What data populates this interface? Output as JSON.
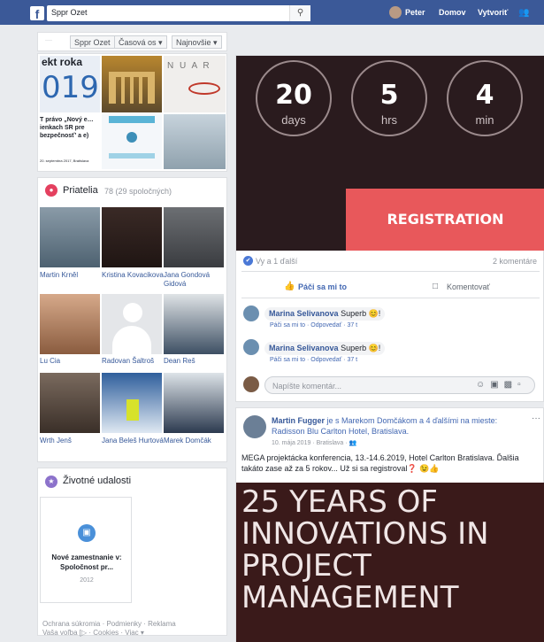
{
  "topbar": {
    "search_value": "Sppr Ozet",
    "user_name": "Peter",
    "home_label": "Domov",
    "create_label": "Vytvoriť"
  },
  "tabs": {
    "tab1": "Sppr Ozet",
    "tab2": "Časová os ▾",
    "tab3": "Najnovšie ▾"
  },
  "photos": {
    "tile1_text": "ekt roka",
    "tile1_year": "019",
    "tile3_text": "N U A R",
    "tile4_text": "T právo „Nový e… ienkach SR pre bezpečnosť' a e)",
    "tile4_date": "20. septembra 2017, Bratislava"
  },
  "friends": {
    "title": "Priatelia",
    "count": "78 (29 spoločných)",
    "list": [
      {
        "name": "Martin Krněl"
      },
      {
        "name": "Kristina Kovacikova"
      },
      {
        "name": "Jana Gondová Gidová"
      },
      {
        "name": "Lu Cia"
      },
      {
        "name": "Radovan Šaltroš"
      },
      {
        "name": "Dean Reš"
      },
      {
        "name": "Wrth Jenš"
      },
      {
        "name": "Jana Beleš Hurtová"
      },
      {
        "name": "Marek Domčák"
      }
    ]
  },
  "life_events": {
    "title": "Životné udalosti",
    "event_title": "Nové zamestnanie v: Spoločnost pr...",
    "event_year": "2012"
  },
  "footer": {
    "line1": "Ochrana súkromia · Podmienky · Reklama",
    "line2": "Vaša voľba [▷ · Cookies · Viac ▾"
  },
  "post1": {
    "countdown": [
      {
        "value": "20",
        "label": "days"
      },
      {
        "value": "5",
        "label": "hrs"
      },
      {
        "value": "4",
        "label": "min"
      }
    ],
    "registration_label": "REGISTRATION",
    "reactions": "Vy a 1 ďalší",
    "comment_count": "2 komentáre",
    "like_label": "Páči sa mi to",
    "comment_label": "Komentovať",
    "comments": [
      {
        "author": "Marina Selivanova",
        "text": "Superb 😊!",
        "meta": "Páči sa mi to · Odpovedať · 37 t"
      },
      {
        "author": "Marina Selivanova",
        "text": "Superb 😊!",
        "meta": "Páči sa mi to · Odpovedať · 37 t"
      }
    ],
    "comment_placeholder": "Napíšte komentár..."
  },
  "post2": {
    "author": "Martin Fugger",
    "header_rest": "je s Marekom Domčákom a 4 ďalšími na mieste: Radisson Blu Carlton Hotel, Bratislava.",
    "date": "10. mája 2019 · Bratislava · 👥",
    "more": "···",
    "body": "MEGA projektácka konferencia, 13.-14.6.2019, Hotel Carlton Bratislava. Ďalšia takáto zase až za 5 rokov... Už si sa registroval❓ 😉👍",
    "poster_line1": "25 YEARS OF",
    "poster_line2": "INNOVATIONS IN",
    "poster_line3": "PROJECT",
    "poster_line4": "MANAGEMENT"
  }
}
